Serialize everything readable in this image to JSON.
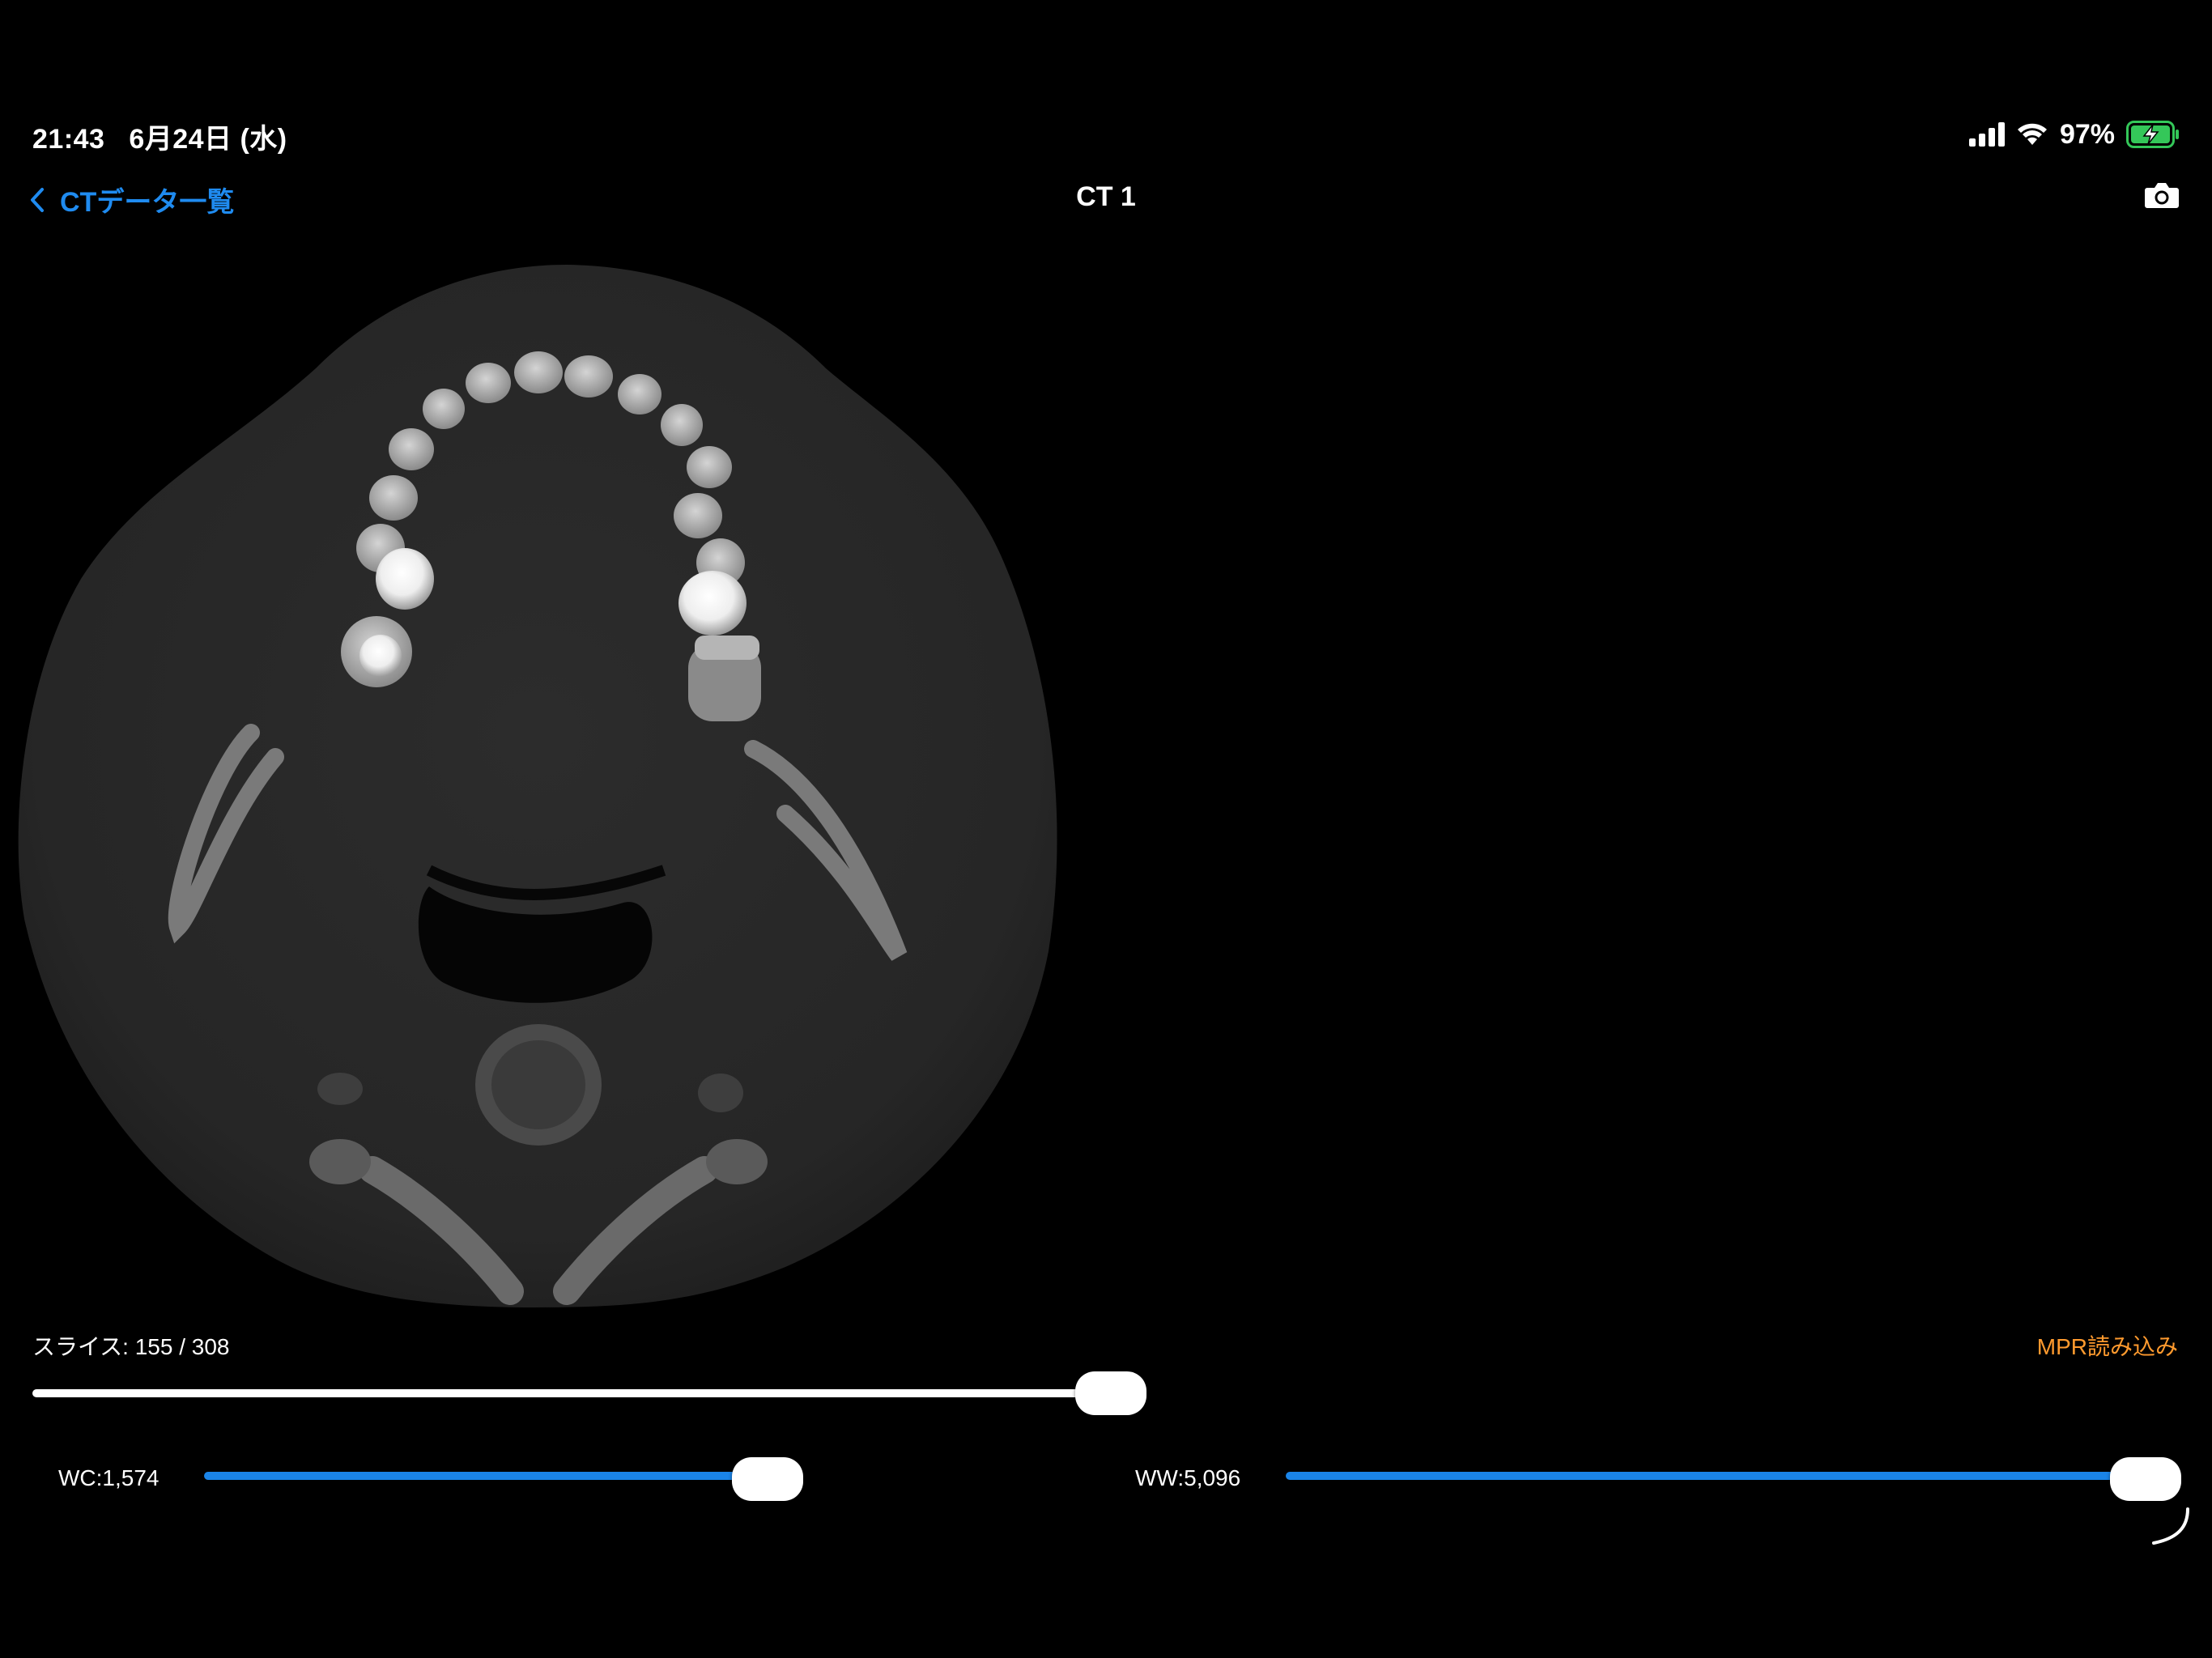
{
  "status_bar": {
    "time": "21:43",
    "date": "6月24日 (水)",
    "battery_percent": "97%",
    "signal_bars": 4,
    "battery_level": 0.97,
    "battery_charging": true
  },
  "nav_bar": {
    "back_label": "CTデータ一覧",
    "title": "CT 1",
    "right_icon": "camera-icon"
  },
  "viewer": {
    "slice_label": "スライス: 155 / 308",
    "slice_current": 155,
    "slice_total": 308,
    "mpr_link": "MPR読み込み",
    "wc_label": "WC:1,574",
    "wc_level": 0.92,
    "ww_label": "WW:5,096",
    "ww_level": 0.98
  },
  "colors": {
    "accent": "#1f8bf0",
    "slider_fill": "#1a84e8",
    "link_orange": "#ff9a2e",
    "battery_green": "#34c759"
  }
}
